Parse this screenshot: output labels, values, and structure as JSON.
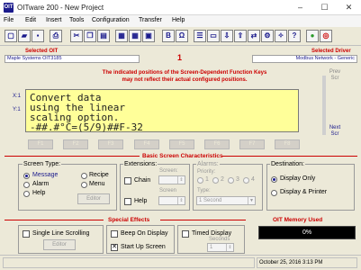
{
  "window": {
    "icon_text": "OIT",
    "title": "OITware 200 - New Project"
  },
  "menu": [
    "File",
    "Edit",
    "Insert",
    "Tools",
    "Configuration",
    "Transfer",
    "Help"
  ],
  "toolbar": {
    "buttons": [
      {
        "icon": "new-file-icon",
        "glyph": "▢"
      },
      {
        "icon": "open-folder-icon",
        "glyph": "▰"
      },
      {
        "icon": "save-icon",
        "glyph": "▪"
      },
      {
        "icon": "print-icon",
        "glyph": "⎙"
      },
      {
        "icon": "cut-icon",
        "glyph": "✂"
      },
      {
        "icon": "copy-icon",
        "glyph": "❐"
      },
      {
        "icon": "paste-icon",
        "glyph": "▤"
      },
      {
        "icon": "insert-before-icon",
        "glyph": "▦"
      },
      {
        "icon": "insert-after-icon",
        "glyph": "▦"
      },
      {
        "icon": "delete-icon",
        "glyph": "▣"
      },
      {
        "icon": "bold-icon",
        "glyph": "B"
      },
      {
        "icon": "omega-icon",
        "glyph": "Ω"
      },
      {
        "icon": "list-icon",
        "glyph": "☰"
      },
      {
        "icon": "monitor-icon",
        "glyph": "▭"
      },
      {
        "icon": "download-icon",
        "glyph": "⇩"
      },
      {
        "icon": "upload-icon",
        "glyph": "⇧"
      },
      {
        "icon": "transfer-icon",
        "glyph": "⇄"
      },
      {
        "icon": "settings-icon",
        "glyph": "⚙"
      },
      {
        "icon": "compass-icon",
        "glyph": "✧"
      },
      {
        "icon": "help-book-icon",
        "glyph": "?"
      },
      {
        "icon": "green-dot-icon",
        "glyph": "●"
      },
      {
        "icon": "target-icon",
        "glyph": "◎"
      }
    ]
  },
  "header": {
    "selected_oit_label": "Selected OIT",
    "selected_oit_value": "Maple Systems OIT3185",
    "screen_number": "1",
    "selected_driver_label": "Selected Driver",
    "selected_driver_value": "Modbus Network - Generic"
  },
  "notice": {
    "line1": "The indicated positions of the Screen-Dependent Function Keys",
    "line2": "may not reflect their actual configured positions."
  },
  "side": {
    "x1": "X:1",
    "y1": "Y:1",
    "prev": "Prev Scr",
    "next": "Next Scr"
  },
  "display": {
    "lines": [
      "Convert data",
      "using the linear",
      "scaling option.",
      "-##.#°C=(5/9)##F-32"
    ]
  },
  "function_keys": [
    "F1",
    "F2",
    "F3",
    "F4",
    "F5",
    "F6",
    "F7",
    "F8"
  ],
  "basic": {
    "title": "Basic Screen Characteristics",
    "screen_type": {
      "title": "Screen Type:",
      "options": [
        "Message",
        "Alarm",
        "Help",
        "Recipe",
        "Menu"
      ],
      "selected": "Message",
      "editor_label": "Editor"
    },
    "extensions": {
      "title": "Extensions:",
      "chain_label": "Chain",
      "help_label": "Help",
      "screen_label_1": "Screen:",
      "screen_label_2": "Screen"
    },
    "alarms": {
      "title": "Alarms:",
      "priority_label": "Priority:",
      "priorities": [
        "1",
        "2",
        "3",
        "4"
      ],
      "type_label": "Type:",
      "type_value": "1 Second"
    },
    "destination": {
      "title": "Destination:",
      "options": [
        "Display Only",
        "Display & Printer"
      ],
      "selected": "Display Only"
    }
  },
  "special": {
    "title": "Special Effects",
    "single_line_scrolling": "Single Line Scrolling",
    "editor_label": "Editor",
    "beep_on_display": "Beep On Display",
    "start_up_screen": "Start Up Screen",
    "start_up_checked": true,
    "timed_display": "Timed Display",
    "seconds_label": "Seconds",
    "seconds_value": "1"
  },
  "memory": {
    "title": "OIT Memory Used",
    "value": "0%"
  },
  "status": {
    "date": "October 25, 2016",
    "time": "3:13 PM"
  }
}
